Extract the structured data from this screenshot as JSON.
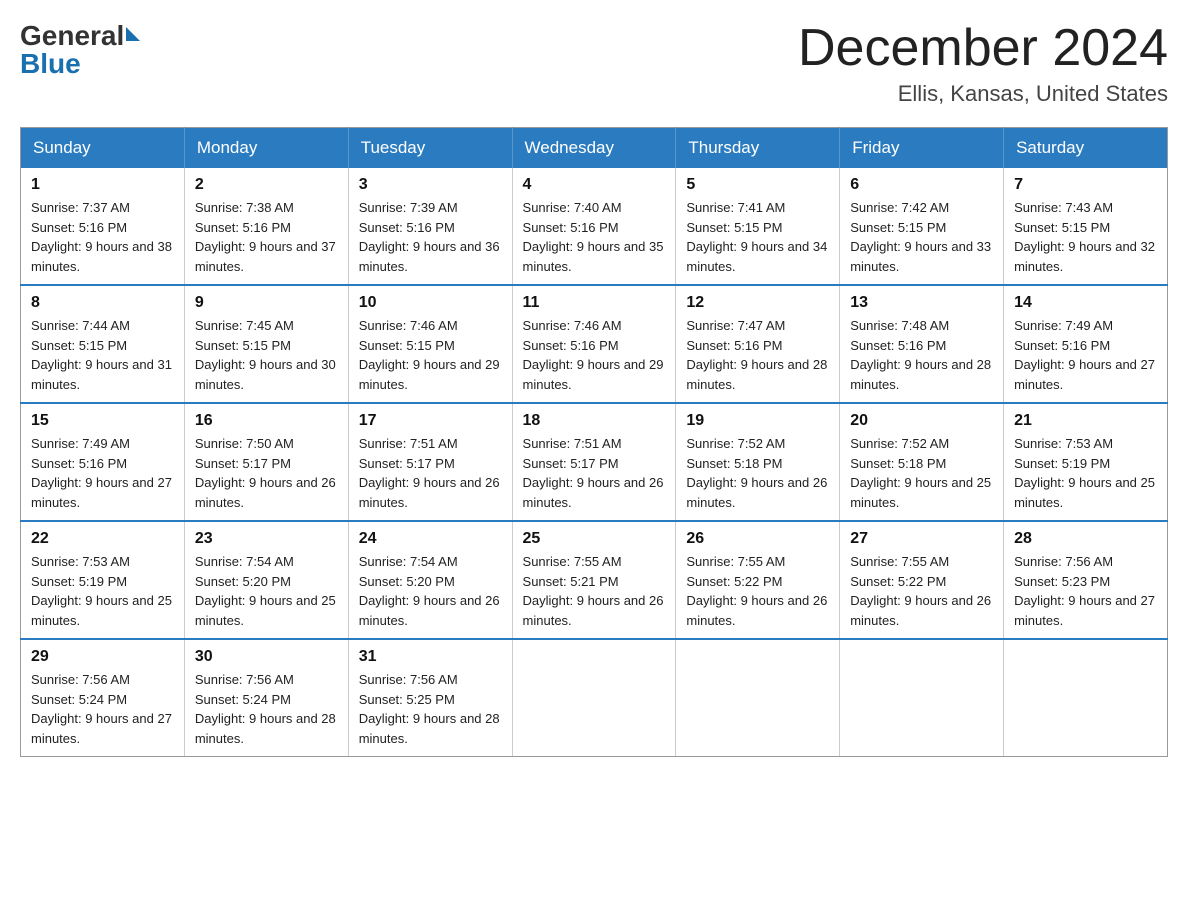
{
  "logo": {
    "general": "General",
    "blue": "Blue"
  },
  "title": "December 2024",
  "location": "Ellis, Kansas, United States",
  "weekdays": [
    "Sunday",
    "Monday",
    "Tuesday",
    "Wednesday",
    "Thursday",
    "Friday",
    "Saturday"
  ],
  "weeks": [
    [
      {
        "day": "1",
        "sunrise": "7:37 AM",
        "sunset": "5:16 PM",
        "daylight": "9 hours and 38 minutes."
      },
      {
        "day": "2",
        "sunrise": "7:38 AM",
        "sunset": "5:16 PM",
        "daylight": "9 hours and 37 minutes."
      },
      {
        "day": "3",
        "sunrise": "7:39 AM",
        "sunset": "5:16 PM",
        "daylight": "9 hours and 36 minutes."
      },
      {
        "day": "4",
        "sunrise": "7:40 AM",
        "sunset": "5:16 PM",
        "daylight": "9 hours and 35 minutes."
      },
      {
        "day": "5",
        "sunrise": "7:41 AM",
        "sunset": "5:15 PM",
        "daylight": "9 hours and 34 minutes."
      },
      {
        "day": "6",
        "sunrise": "7:42 AM",
        "sunset": "5:15 PM",
        "daylight": "9 hours and 33 minutes."
      },
      {
        "day": "7",
        "sunrise": "7:43 AM",
        "sunset": "5:15 PM",
        "daylight": "9 hours and 32 minutes."
      }
    ],
    [
      {
        "day": "8",
        "sunrise": "7:44 AM",
        "sunset": "5:15 PM",
        "daylight": "9 hours and 31 minutes."
      },
      {
        "day": "9",
        "sunrise": "7:45 AM",
        "sunset": "5:15 PM",
        "daylight": "9 hours and 30 minutes."
      },
      {
        "day": "10",
        "sunrise": "7:46 AM",
        "sunset": "5:15 PM",
        "daylight": "9 hours and 29 minutes."
      },
      {
        "day": "11",
        "sunrise": "7:46 AM",
        "sunset": "5:16 PM",
        "daylight": "9 hours and 29 minutes."
      },
      {
        "day": "12",
        "sunrise": "7:47 AM",
        "sunset": "5:16 PM",
        "daylight": "9 hours and 28 minutes."
      },
      {
        "day": "13",
        "sunrise": "7:48 AM",
        "sunset": "5:16 PM",
        "daylight": "9 hours and 28 minutes."
      },
      {
        "day": "14",
        "sunrise": "7:49 AM",
        "sunset": "5:16 PM",
        "daylight": "9 hours and 27 minutes."
      }
    ],
    [
      {
        "day": "15",
        "sunrise": "7:49 AM",
        "sunset": "5:16 PM",
        "daylight": "9 hours and 27 minutes."
      },
      {
        "day": "16",
        "sunrise": "7:50 AM",
        "sunset": "5:17 PM",
        "daylight": "9 hours and 26 minutes."
      },
      {
        "day": "17",
        "sunrise": "7:51 AM",
        "sunset": "5:17 PM",
        "daylight": "9 hours and 26 minutes."
      },
      {
        "day": "18",
        "sunrise": "7:51 AM",
        "sunset": "5:17 PM",
        "daylight": "9 hours and 26 minutes."
      },
      {
        "day": "19",
        "sunrise": "7:52 AM",
        "sunset": "5:18 PM",
        "daylight": "9 hours and 26 minutes."
      },
      {
        "day": "20",
        "sunrise": "7:52 AM",
        "sunset": "5:18 PM",
        "daylight": "9 hours and 25 minutes."
      },
      {
        "day": "21",
        "sunrise": "7:53 AM",
        "sunset": "5:19 PM",
        "daylight": "9 hours and 25 minutes."
      }
    ],
    [
      {
        "day": "22",
        "sunrise": "7:53 AM",
        "sunset": "5:19 PM",
        "daylight": "9 hours and 25 minutes."
      },
      {
        "day": "23",
        "sunrise": "7:54 AM",
        "sunset": "5:20 PM",
        "daylight": "9 hours and 25 minutes."
      },
      {
        "day": "24",
        "sunrise": "7:54 AM",
        "sunset": "5:20 PM",
        "daylight": "9 hours and 26 minutes."
      },
      {
        "day": "25",
        "sunrise": "7:55 AM",
        "sunset": "5:21 PM",
        "daylight": "9 hours and 26 minutes."
      },
      {
        "day": "26",
        "sunrise": "7:55 AM",
        "sunset": "5:22 PM",
        "daylight": "9 hours and 26 minutes."
      },
      {
        "day": "27",
        "sunrise": "7:55 AM",
        "sunset": "5:22 PM",
        "daylight": "9 hours and 26 minutes."
      },
      {
        "day": "28",
        "sunrise": "7:56 AM",
        "sunset": "5:23 PM",
        "daylight": "9 hours and 27 minutes."
      }
    ],
    [
      {
        "day": "29",
        "sunrise": "7:56 AM",
        "sunset": "5:24 PM",
        "daylight": "9 hours and 27 minutes."
      },
      {
        "day": "30",
        "sunrise": "7:56 AM",
        "sunset": "5:24 PM",
        "daylight": "9 hours and 28 minutes."
      },
      {
        "day": "31",
        "sunrise": "7:56 AM",
        "sunset": "5:25 PM",
        "daylight": "9 hours and 28 minutes."
      },
      null,
      null,
      null,
      null
    ]
  ]
}
